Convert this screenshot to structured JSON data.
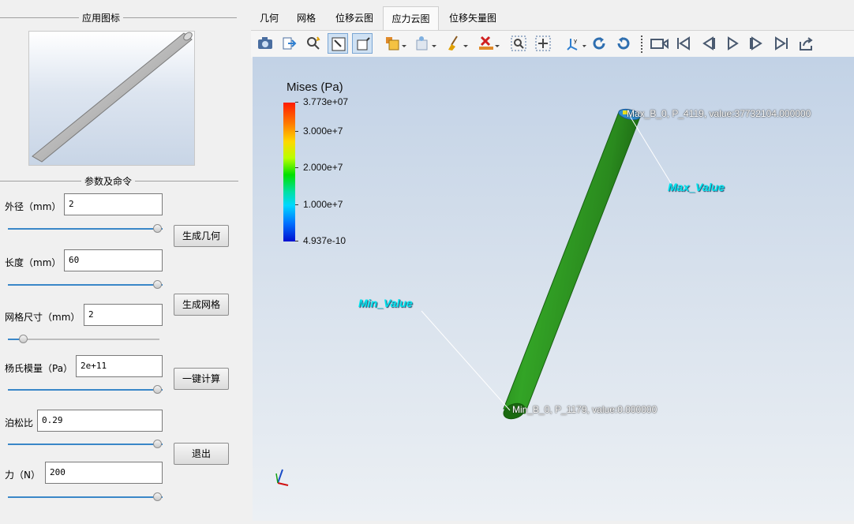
{
  "left_panel": {
    "icon_group_title": "应用图标",
    "params_group_title": "参数及命令",
    "params": [
      {
        "label": "外径（mm）",
        "value": "2",
        "slider": 1.0
      },
      {
        "label": "长度（mm）",
        "value": "60",
        "slider": 1.0
      },
      {
        "label": "网格尺寸（mm）",
        "value": "2",
        "slider": 0.1
      },
      {
        "label": "杨氏模量（Pa）",
        "value": "2e+11",
        "slider": 1.0
      },
      {
        "label": "泊松比",
        "value": "0.29",
        "slider": 1.0
      },
      {
        "label": "力（N）",
        "value": "200",
        "slider": 1.0
      }
    ],
    "buttons": {
      "gen_geometry": "生成几何",
      "gen_mesh": "生成网格",
      "compute": "一键计算",
      "exit": "退出"
    }
  },
  "tabs": [
    {
      "label": "几何",
      "active": false
    },
    {
      "label": "网格",
      "active": false
    },
    {
      "label": "位移云图",
      "active": false
    },
    {
      "label": "应力云图",
      "active": true
    },
    {
      "label": "位移矢量图",
      "active": false
    }
  ],
  "toolbar": [
    "camera-icon",
    "export-icon",
    "zoom-select-icon",
    "select-cell-icon",
    "select-point-icon",
    "representation-icon",
    "light-icon",
    "clear-icon",
    "delete-icon",
    "zoom-box-icon",
    "fit-view-icon",
    "axes-icon",
    "rotate-cw-icon",
    "rotate-ccw-icon",
    "record-icon",
    "first-frame-icon",
    "prev-frame-icon",
    "play-icon",
    "next-frame-icon",
    "last-frame-icon",
    "share-icon"
  ],
  "viewport": {
    "colorbar": {
      "title": "Mises (Pa)",
      "labels": [
        "3.773e+07",
        "3.000e+7",
        "2.000e+7",
        "1.000e+7",
        "4.937e-10"
      ]
    },
    "max_annotation": "Max_B_0, P_4119, value:37732104.000000",
    "min_annotation": "Min_B_0, P_1179, value:0.000000",
    "max_label": "Max_Value",
    "min_label": "Min_Value",
    "colors": {
      "bar": "#2e9a22",
      "bar_dark": "#1d6e14",
      "cyan": "#00e4ee"
    }
  }
}
